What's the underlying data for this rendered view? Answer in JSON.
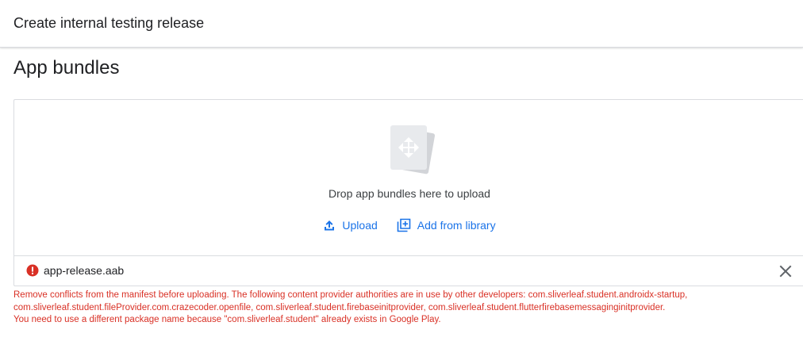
{
  "header": {
    "title": "Create internal testing release"
  },
  "section": {
    "title": "App bundles"
  },
  "dropzone": {
    "icon": "app-bundle-stack-icon",
    "text": "Drop app bundles here to upload",
    "upload_label": "Upload",
    "upload_icon": "upload-icon",
    "library_label": "Add from library",
    "library_icon": "add-library-icon"
  },
  "file": {
    "name": "app-release.aab",
    "status_icon": "error-icon",
    "remove_icon": "close-icon"
  },
  "errors": [
    "Remove conflicts from the manifest before uploading. The following content provider authorities are in use by other developers: com.sliverleaf.student.androidx-startup,",
    "com.sliverleaf.student.fileProvider.com.crazecoder.openfile, com.sliverleaf.student.firebaseinitprovider, com.sliverleaf.student.flutterfirebasemessaginginitprovider.",
    "You need to use a different package name because \"com.sliverleaf.student\" already exists in Google Play."
  ],
  "colors": {
    "accent": "#1a73e8",
    "error": "#d93025",
    "border": "#dadce0",
    "text": "#202124"
  }
}
